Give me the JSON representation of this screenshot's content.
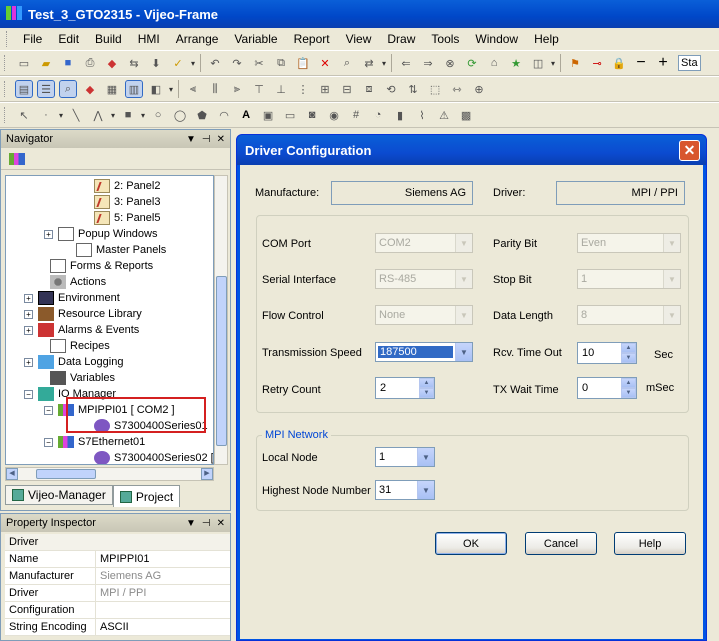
{
  "window": {
    "title": "Test_3_GTO2315 - Vijeo-Frame"
  },
  "menu": [
    "File",
    "Edit",
    "Build",
    "HMI",
    "Arrange",
    "Variable",
    "Report",
    "View",
    "Draw",
    "Tools",
    "Window",
    "Help"
  ],
  "toolbar1_tail": "Sta",
  "navigator": {
    "title": "Navigator",
    "tree": [
      {
        "label": "2: Panel2",
        "icon": "panel"
      },
      {
        "label": "3: Panel3",
        "icon": "panel"
      },
      {
        "label": "5: Panel5",
        "icon": "panel"
      },
      {
        "label": "Popup Windows",
        "icon": "folder",
        "exp": "+"
      },
      {
        "label": "Master Panels",
        "icon": "folder"
      },
      {
        "label": "Forms & Reports",
        "icon": "folder"
      },
      {
        "label": "Actions",
        "icon": "gear"
      },
      {
        "label": "Environment",
        "icon": "env",
        "exp": "+"
      },
      {
        "label": "Resource Library",
        "icon": "lib",
        "exp": "+"
      },
      {
        "label": "Alarms & Events",
        "icon": "alarm",
        "exp": "+"
      },
      {
        "label": "Recipes",
        "icon": "folder"
      },
      {
        "label": "Data Logging",
        "icon": "log",
        "exp": "+"
      },
      {
        "label": "Variables",
        "icon": "var"
      },
      {
        "label": "IO Manager",
        "icon": "io",
        "exp": "-"
      },
      {
        "label": "MPIPPI01 [ COM2 ]",
        "icon": "drv",
        "exp": "-"
      },
      {
        "label": "S7300400Series01",
        "icon": "dot"
      },
      {
        "label": "S7Ethernet01",
        "icon": "drv",
        "exp": "-"
      },
      {
        "label": "S7300400Series02 [",
        "icon": "dot"
      }
    ],
    "tabs": [
      "Vijeo-Manager",
      "Project"
    ]
  },
  "property_inspector": {
    "title": "Property Inspector",
    "header": "Driver",
    "rows": [
      {
        "k": "Name",
        "v": "MPIPPI01"
      },
      {
        "k": "Manufacturer",
        "v": "Siemens AG"
      },
      {
        "k": "Driver",
        "v": "MPI / PPI"
      },
      {
        "k": "Configuration",
        "v": ""
      },
      {
        "k": "String Encoding",
        "v": "ASCII"
      }
    ]
  },
  "dialog": {
    "title": "Driver Configuration",
    "manufacture_label": "Manufacture:",
    "manufacture_value": "Siemens AG",
    "driver_label": "Driver:",
    "driver_value": "MPI / PPI",
    "com_port_label": "COM Port",
    "com_port": "COM2",
    "serial_label": "Serial Interface",
    "serial": "RS-485",
    "flow_label": "Flow Control",
    "flow": "None",
    "speed_label": "Transmission Speed",
    "speed": "187500",
    "retry_label": "Retry Count",
    "retry": "2",
    "parity_label": "Parity Bit",
    "parity": "Even",
    "stop_label": "Stop Bit",
    "stop": "1",
    "datalen_label": "Data Length",
    "datalen": "8",
    "rcv_label": "Rcv. Time Out",
    "rcv": "10",
    "rcv_unit": "Sec",
    "tx_label": "TX Wait Time",
    "tx": "0",
    "tx_unit": "mSec",
    "mpi_group": "MPI Network",
    "local_label": "Local Node",
    "local": "1",
    "highest_label": "Highest Node Number",
    "highest": "31",
    "ok": "OK",
    "cancel": "Cancel",
    "help": "Help"
  }
}
